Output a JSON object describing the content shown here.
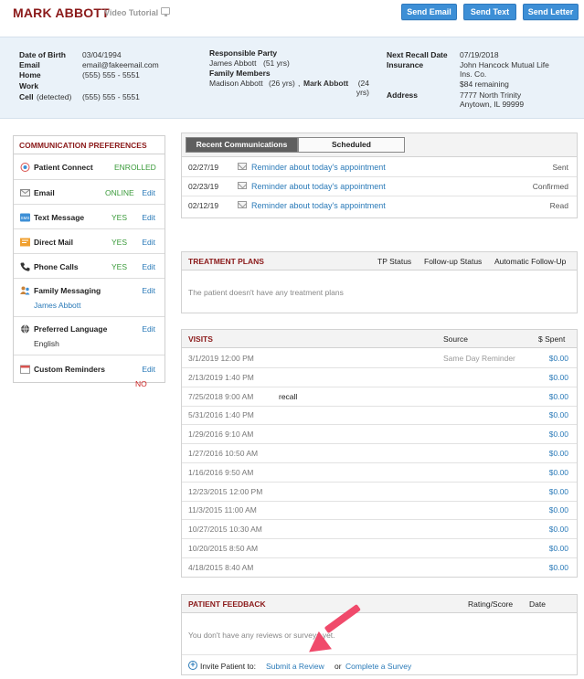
{
  "header": {
    "patient_name": "MARK ABBOTT",
    "video_tutorial": "Video Tutorial",
    "buttons": {
      "send_email": "Send Email",
      "send_text": "Send Text",
      "send_letter": "Send Letter"
    }
  },
  "info": {
    "dob_label": "Date of Birth",
    "dob": "03/04/1994",
    "email_label": "Email",
    "email": "email@fakeemail.com",
    "home_label": "Home",
    "home": "(555) 555 - 5551",
    "work_label": "Work",
    "cell_label": "Cell",
    "cell_note": "(detected)",
    "cell": "(555) 555 - 5551",
    "resp_party_label": "Responsible Party",
    "resp_party": "James Abbott",
    "resp_party_age": "(51 yrs)",
    "family_label": "Family Members",
    "family_1": "Madison Abbott",
    "family_1_age": "(26 yrs)",
    "family_sep": ",",
    "family_2": "Mark Abbott",
    "family_2_age": "(24 yrs)",
    "recall_label": "Next Recall Date",
    "recall": "07/19/2018",
    "insurance_label": "Insurance",
    "insurance": "John Hancock Mutual Life Ins. Co.",
    "insurance_remaining": "$84 remaining",
    "address_label": "Address",
    "address_1": "7777 North Trinity",
    "address_2": "Anytown, IL 99999"
  },
  "prefs": {
    "title": "COMMUNICATION PREFERENCES",
    "items": [
      {
        "name": "Patient Connect",
        "status": "ENROLLED",
        "edit": ""
      },
      {
        "name": "Email",
        "status": "ONLINE",
        "edit": "Edit"
      },
      {
        "name": "Text Message",
        "status": "YES",
        "edit": "Edit"
      },
      {
        "name": "Direct Mail",
        "status": "YES",
        "edit": "Edit"
      },
      {
        "name": "Phone Calls",
        "status": "YES",
        "edit": "Edit"
      },
      {
        "name": "Family Messaging",
        "status": "",
        "edit": "Edit",
        "sub": "James Abbott"
      },
      {
        "name": "Preferred Language",
        "status": "",
        "edit": "Edit",
        "sub": "English"
      },
      {
        "name": "Custom Reminders",
        "status": "",
        "edit": "Edit"
      }
    ],
    "no_label": "NO"
  },
  "communications": {
    "tab_recent": "Recent Communications",
    "tab_scheduled": "Scheduled",
    "rows": [
      {
        "date": "02/27/19",
        "subject": "Reminder about today's appointment",
        "status": "Sent"
      },
      {
        "date": "02/23/19",
        "subject": "Reminder about today's appointment",
        "status": "Confirmed"
      },
      {
        "date": "02/12/19",
        "subject": "Reminder about today's appointment",
        "status": "Read"
      }
    ]
  },
  "treatment": {
    "title": "TREATMENT PLANS",
    "col_tp_status": "TP Status",
    "col_followup": "Follow-up Status",
    "col_auto": "Automatic Follow-Up",
    "empty": "The patient doesn't have any treatment plans"
  },
  "visits": {
    "title": "VISITS",
    "col_source": "Source",
    "col_spent": "$ Spent",
    "rows": [
      {
        "date": "3/1/2019 12:00 PM",
        "note": "",
        "source": "Same Day Reminder",
        "spent": "$0.00"
      },
      {
        "date": "2/13/2019 1:40 PM",
        "note": "",
        "source": "",
        "spent": "$0.00"
      },
      {
        "date": "7/25/2018 9:00 AM",
        "note": "recall",
        "source": "",
        "spent": "$0.00"
      },
      {
        "date": "5/31/2016 1:40 PM",
        "note": "",
        "source": "",
        "spent": "$0.00"
      },
      {
        "date": "1/29/2016 9:10 AM",
        "note": "",
        "source": "",
        "spent": "$0.00"
      },
      {
        "date": "1/27/2016 10:50 AM",
        "note": "",
        "source": "",
        "spent": "$0.00"
      },
      {
        "date": "1/16/2016 9:50 AM",
        "note": "",
        "source": "",
        "spent": "$0.00"
      },
      {
        "date": "12/23/2015 12:00 PM",
        "note": "",
        "source": "",
        "spent": "$0.00"
      },
      {
        "date": "11/3/2015 11:00 AM",
        "note": "",
        "source": "",
        "spent": "$0.00"
      },
      {
        "date": "10/27/2015 10:30 AM",
        "note": "",
        "source": "",
        "spent": "$0.00"
      },
      {
        "date": "10/20/2015 8:50 AM",
        "note": "",
        "source": "",
        "spent": "$0.00"
      },
      {
        "date": "4/18/2015 8:40 AM",
        "note": "",
        "source": "",
        "spent": "$0.00"
      }
    ]
  },
  "feedback": {
    "title": "PATIENT FEEDBACK",
    "col_rating": "Rating/Score",
    "col_date": "Date",
    "empty": "You don't have any reviews or surveys yet.",
    "invite_prefix": "Invite Patient to:",
    "submit_review": "Submit a Review",
    "or": "or",
    "complete_survey": "Complete a Survey"
  },
  "colors": {
    "brand_red": "#8b1a1a",
    "button_blue": "#3d8fd6",
    "link_blue": "#2a7ab8",
    "status_green": "#3a9a3a",
    "arrow_pink": "#f04a6b"
  }
}
